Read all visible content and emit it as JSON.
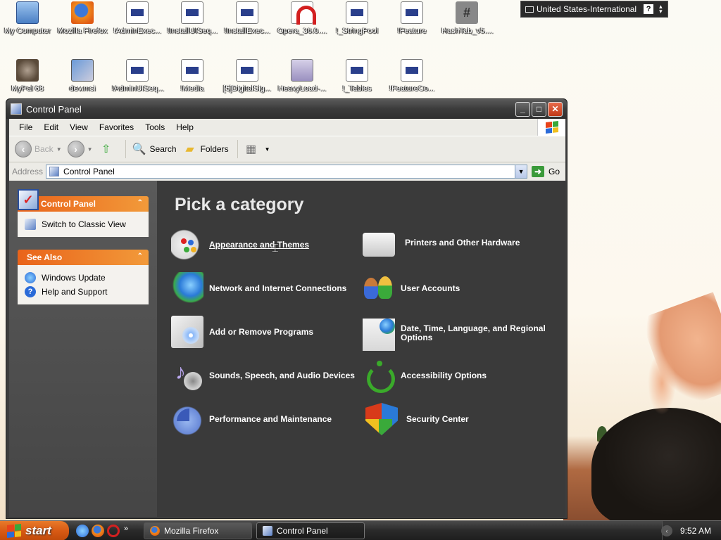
{
  "desktop": {
    "icons_row1": [
      {
        "label": "My Computer",
        "icon": "my-computer-icon"
      },
      {
        "label": "Mozilla Firefox",
        "icon": "firefox-icon"
      },
      {
        "label": "!AdminExec...",
        "icon": "document-icon"
      },
      {
        "label": "!InstallUISeq...",
        "icon": "document-icon"
      },
      {
        "label": "!InstallExec...",
        "icon": "document-icon"
      },
      {
        "label": "Opera_36.0....",
        "icon": "opera-icon"
      },
      {
        "label": "!_StringPool",
        "icon": "document-icon"
      },
      {
        "label": "!Feature",
        "icon": "document-icon"
      },
      {
        "label": "HashTab_v5....",
        "icon": "hashtab-icon"
      }
    ],
    "icons_row2": [
      {
        "label": "MyPal 68",
        "icon": "mypal-icon"
      },
      {
        "label": "dev.msi",
        "icon": "msi-icon"
      },
      {
        "label": "!AdminUISeq...",
        "icon": "document-icon"
      },
      {
        "label": "!Media",
        "icon": "document-icon"
      },
      {
        "label": "[5]DigitalSig...",
        "icon": "document-icon"
      },
      {
        "label": "HeavyLoad-...",
        "icon": "heavyload-icon"
      },
      {
        "label": "!_Tables",
        "icon": "document-icon"
      },
      {
        "label": "!FeatureCo...",
        "icon": "document-icon"
      }
    ]
  },
  "language_bar": {
    "label": "United States-International",
    "help": "?"
  },
  "window": {
    "title": "Control Panel",
    "menu": [
      "File",
      "Edit",
      "View",
      "Favorites",
      "Tools",
      "Help"
    ],
    "toolbar": {
      "back": "Back",
      "search": "Search",
      "folders": "Folders"
    },
    "address": {
      "label": "Address",
      "value": "Control Panel",
      "go": "Go"
    },
    "taskpane": {
      "control_panel": {
        "title": "Control Panel",
        "items": [
          "Switch to Classic View"
        ]
      },
      "see_also": {
        "title": "See Also",
        "items": [
          "Windows Update",
          "Help and Support"
        ]
      }
    },
    "content": {
      "heading": "Pick a category",
      "categories_left": [
        {
          "label": "Appearance and Themes",
          "icon": "appearance-themes-icon"
        },
        {
          "label": "Network and Internet Connections",
          "icon": "network-icon"
        },
        {
          "label": "Add or Remove Programs",
          "icon": "add-remove-programs-icon"
        },
        {
          "label": "Sounds, Speech, and Audio Devices",
          "icon": "sounds-icon"
        },
        {
          "label": "Performance and Maintenance",
          "icon": "performance-icon"
        }
      ],
      "categories_right": [
        {
          "label": "Printers and Other Hardware",
          "icon": "printer-icon"
        },
        {
          "label": "User Accounts",
          "icon": "user-accounts-icon"
        },
        {
          "label": "Date, Time, Language, and Regional Options",
          "icon": "date-time-icon"
        },
        {
          "label": "Accessibility Options",
          "icon": "accessibility-icon"
        },
        {
          "label": "Security Center",
          "icon": "security-shield-icon"
        }
      ]
    }
  },
  "taskbar": {
    "start": "start",
    "more": "»",
    "buttons": [
      {
        "label": "Mozilla Firefox",
        "active": false
      },
      {
        "label": "Control Panel",
        "active": true
      }
    ],
    "clock": "9:52 AM"
  },
  "colors": {
    "taskpane_header": "#e9631a",
    "content_bg": "#3a3a3a",
    "start_button": "#d85a14"
  }
}
